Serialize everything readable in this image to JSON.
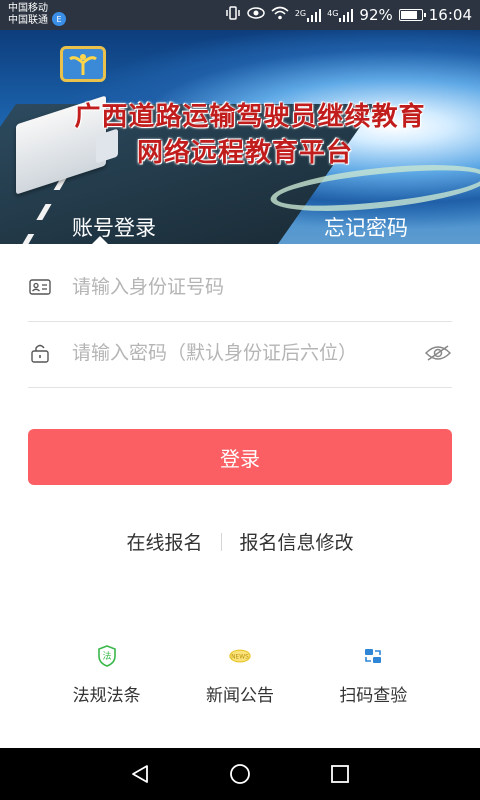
{
  "status_bar": {
    "carrier1": "中国移动",
    "carrier2": "中国联通",
    "carrier_badge": "E",
    "net1": "2G",
    "net2": "4G",
    "battery_percent": "92%",
    "battery_level": 0.92,
    "time": "16:04"
  },
  "banner": {
    "title_line1": "广西道路运输驾驶员继续教育",
    "title_line2": "网络远程教育平台",
    "tabs": [
      {
        "label": "账号登录",
        "active": true
      },
      {
        "label": "忘记密码",
        "active": false
      }
    ],
    "title_color": "#c21d1d"
  },
  "form": {
    "id_placeholder": "请输入身份证号码",
    "id_value": "",
    "password_placeholder": "请输入密码（默认身份证后六位）",
    "password_value": "",
    "login_label": "登录",
    "login_color": "#fb5e63"
  },
  "links": {
    "register": "在线报名",
    "edit_info": "报名信息修改"
  },
  "bottom_menu": [
    {
      "label": "法规法条",
      "icon": "law-shield-icon",
      "color": "#39b84a"
    },
    {
      "label": "新闻公告",
      "icon": "news-icon",
      "color": "#e8c21f"
    },
    {
      "label": "扫码查验",
      "icon": "scan-icon",
      "color": "#2f86d6"
    }
  ],
  "nav_bar": {
    "back": "back-icon",
    "home": "home-icon",
    "recents": "recents-icon"
  }
}
